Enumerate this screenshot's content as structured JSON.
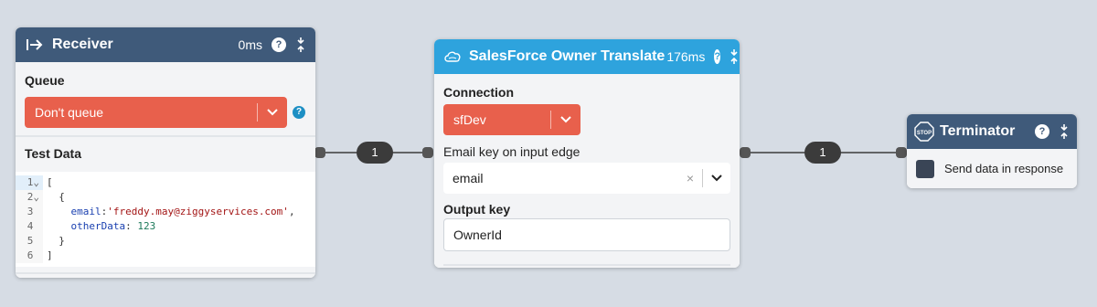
{
  "edges": [
    {
      "label": "1"
    },
    {
      "label": "1"
    }
  ],
  "receiver": {
    "title": "Receiver",
    "time": "0ms",
    "icon": "enter-arrow-icon",
    "help": "?",
    "queue_label": "Queue",
    "queue_value": "Don't queue",
    "queue_help": "?",
    "test_data_label": "Test Data",
    "code_lines": [
      {
        "num": "1",
        "fold": "⌄",
        "parts": [
          {
            "t": "[",
            "c": ""
          }
        ]
      },
      {
        "num": "2",
        "fold": "⌄",
        "parts": [
          {
            "t": "  {",
            "c": ""
          }
        ]
      },
      {
        "num": "3",
        "fold": " ",
        "parts": [
          {
            "t": "    ",
            "c": ""
          },
          {
            "t": "email",
            "c": "tok-key"
          },
          {
            "t": ":",
            "c": ""
          },
          {
            "t": "'freddy.may@ziggyservices.com'",
            "c": "tok-str"
          },
          {
            "t": ",",
            "c": ""
          }
        ]
      },
      {
        "num": "4",
        "fold": " ",
        "parts": [
          {
            "t": "    ",
            "c": ""
          },
          {
            "t": "otherData",
            "c": "tok-key"
          },
          {
            "t": ": ",
            "c": ""
          },
          {
            "t": "123",
            "c": "tok-num"
          }
        ]
      },
      {
        "num": "5",
        "fold": " ",
        "parts": [
          {
            "t": "  }",
            "c": ""
          }
        ]
      },
      {
        "num": "6",
        "fold": " ",
        "parts": [
          {
            "t": "]",
            "c": ""
          }
        ]
      }
    ]
  },
  "translate": {
    "title": "SalesForce Owner Translate",
    "time": "176ms",
    "icon": "salesforce-cloud-icon",
    "help": "?",
    "connection_label": "Connection",
    "connection_value": "sfDev",
    "email_key_label": "Email key on input edge",
    "email_key_value": "email",
    "clear_glyph": "×",
    "output_key_label": "Output key",
    "output_key_value": "OwnerId"
  },
  "terminator": {
    "title": "Terminator",
    "icon": "stop-sign-icon",
    "stop_text": "STOP",
    "help": "?",
    "checkbox_label": "Send data in response"
  },
  "colors": {
    "canvas": "#d6dce4",
    "header_dark": "#3f5a7a",
    "header_blue": "#2ea3dd",
    "select_red": "#e8604c",
    "edge": "#3b3b3b"
  }
}
